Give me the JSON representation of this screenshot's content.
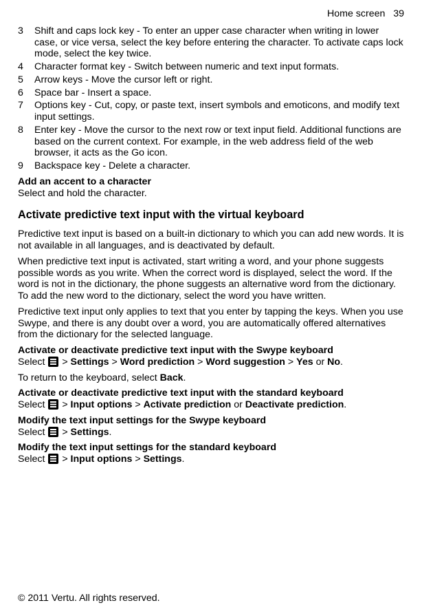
{
  "header": {
    "section": "Home screen",
    "page_number": "39"
  },
  "numbered_items": [
    {
      "n": "3",
      "t": "Shift and caps lock key - To enter an upper case character when writing in lower case, or vice versa, select the key before entering the character. To activate caps lock mode, select the key twice."
    },
    {
      "n": "4",
      "t": "Character format key - Switch between numeric and text input formats."
    },
    {
      "n": "5",
      "t": "Arrow keys - Move the cursor left or right."
    },
    {
      "n": "6",
      "t": "Space bar - Insert a space."
    },
    {
      "n": "7",
      "t": "Options key - Cut, copy, or paste text, insert symbols and emoticons, and modify text input settings."
    },
    {
      "n": "8",
      "t": "Enter key - Move the cursor to the next row or text input field. Additional functions are based on the current context. For example, in the web address field of the web browser, it acts as the Go icon."
    },
    {
      "n": "9",
      "t": "Backspace key - Delete a character."
    }
  ],
  "accent": {
    "heading": "Add an accent to a character",
    "body": "Select and hold the character."
  },
  "predictive": {
    "heading": "Activate predictive text input with the virtual keyboard",
    "p1": "Predictive text input is based on a built-in dictionary to which you can add new words. It is not available in all languages, and is deactivated by default.",
    "p2": "When predictive text input is activated, start writing a word, and your phone suggests possible words as you write. When the correct word is displayed, select the word. If the word is not in the dictionary, the phone suggests an alternative word from the dictionary. To add the new word to the dictionary, select the word you have written.",
    "p3": "Predictive text input only applies to text that you enter by tapping the keys. When you use Swype, and there is any doubt over a word, you are automatically offered alternatives from the dictionary for the selected language."
  },
  "swype_predict": {
    "heading": "Activate or deactivate predictive text input with the Swype keyboard",
    "select_label": "Select ",
    "gt": " > ",
    "s1": "Settings",
    "s2": "Word prediction",
    "s3": "Word suggestion",
    "yes": "Yes",
    "or": " or ",
    "no": "No",
    "period": ".",
    "return_line_pre": "To return to the keyboard, select ",
    "back": "Back",
    "return_line_post": "."
  },
  "std_predict": {
    "heading": "Activate or deactivate predictive text input with the standard keyboard",
    "select_label": "Select ",
    "gt": " > ",
    "s1": "Input options",
    "s2a": "Activate prediction",
    "or": " or ",
    "s2b": "Deactivate prediction",
    "period": "."
  },
  "swype_settings": {
    "heading": "Modify the text input settings for the Swype keyboard",
    "select_label": "Select ",
    "gt": " > ",
    "s1": "Settings",
    "period": "."
  },
  "std_settings": {
    "heading": "Modify the text input settings for the standard keyboard",
    "select_label": "Select ",
    "gt": " > ",
    "s1": "Input options",
    "s2": "Settings",
    "period": "."
  },
  "footer": "© 2011 Vertu. All rights reserved."
}
